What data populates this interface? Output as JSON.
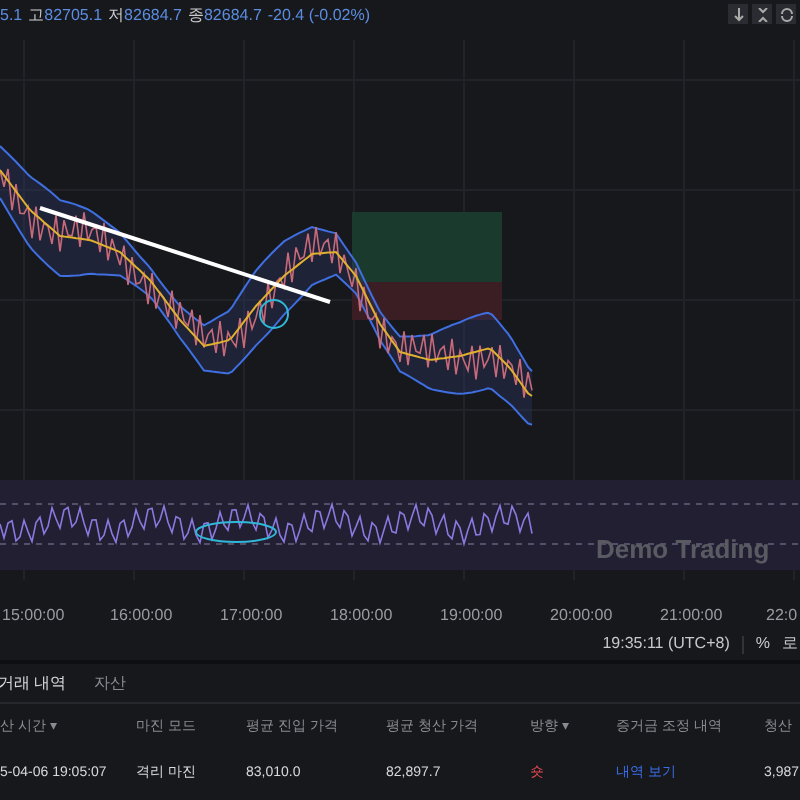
{
  "legend": [
    {
      "value": "5.1"
    },
    {
      "label": "고",
      "value": "82705.1"
    },
    {
      "label": "저",
      "value": "82684.7"
    },
    {
      "label": "종",
      "value": "82684.7"
    },
    {
      "value": "-20.4 (-0.02%)"
    }
  ],
  "watermark": "Demo Trading",
  "time_axis": [
    "15:00:00",
    "16:00:00",
    "17:00:00",
    "18:00:00",
    "19:00:00",
    "20:00:00",
    "21:00:00",
    "22:0"
  ],
  "status_bar": {
    "clock": "19:35:11 (UTC+8)",
    "percent": "%",
    "log": "로"
  },
  "tabs": [
    {
      "label": "거래 내역",
      "selected": true
    },
    {
      "label": "자산",
      "selected": false
    }
  ],
  "table": {
    "columns": [
      "산 시간 ▾",
      "마진 모드",
      "평균 진입 가격",
      "평균 청산 가격",
      "방향 ▾",
      "증거금 조정 내역",
      "청산"
    ],
    "rows": [
      [
        {
          "text": "5-04-06 19:05:07",
          "kind": "text"
        },
        {
          "text": "격리 마진",
          "kind": "text"
        },
        {
          "text": "83,010.0",
          "kind": "text"
        },
        {
          "text": "82,897.7",
          "kind": "text"
        },
        {
          "text": "숏",
          "kind": "short"
        },
        {
          "text": "내역 보기",
          "kind": "link"
        },
        {
          "text": "3,987",
          "kind": "text"
        }
      ]
    ]
  }
}
